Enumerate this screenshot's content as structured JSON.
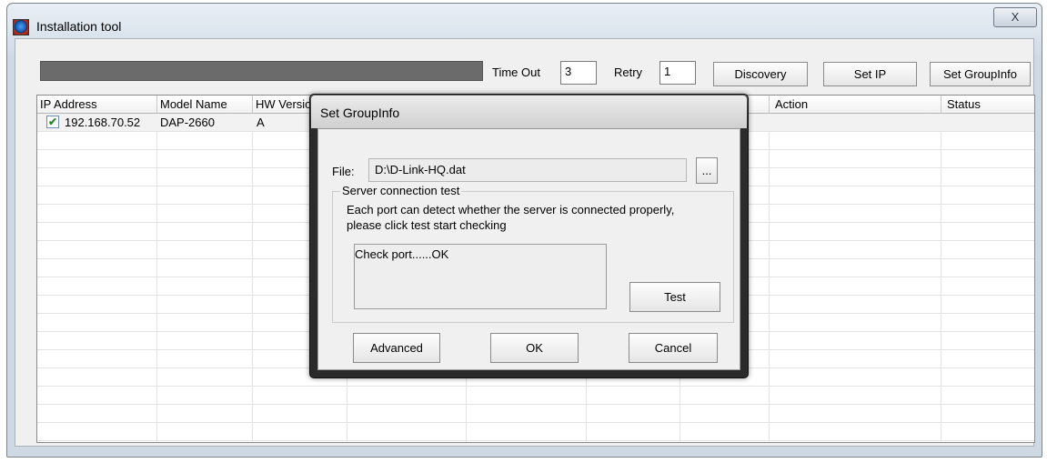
{
  "window": {
    "title": "Installation tool",
    "close_glyph": "X"
  },
  "toolbar": {
    "timeout_label": "Time Out",
    "timeout_value": "3",
    "retry_label": "Retry",
    "retry_value": "1",
    "discovery_label": "Discovery",
    "setip_label": "Set IP",
    "setgroupinfo_label": "Set GroupInfo"
  },
  "grid": {
    "columns": [
      "IP Address",
      "Model Name",
      "HW Version",
      "",
      "",
      "",
      "",
      "Action",
      "Status"
    ],
    "rows": [
      {
        "checked": true,
        "ip": "192.168.70.52",
        "model": "DAP-2660",
        "hw": "A"
      }
    ]
  },
  "dialog": {
    "title": "Set GroupInfo",
    "file_label": "File:",
    "file_value": "D:\\D-Link-HQ.dat",
    "browse_label": "...",
    "group_title": "Server connection test",
    "description_line1": "Each port can detect whether the server is connected properly,",
    "description_line2": "please click test start checking",
    "result_text": "Check port......OK",
    "test_label": "Test",
    "advanced_label": "Advanced",
    "ok_label": "OK",
    "cancel_label": "Cancel"
  }
}
